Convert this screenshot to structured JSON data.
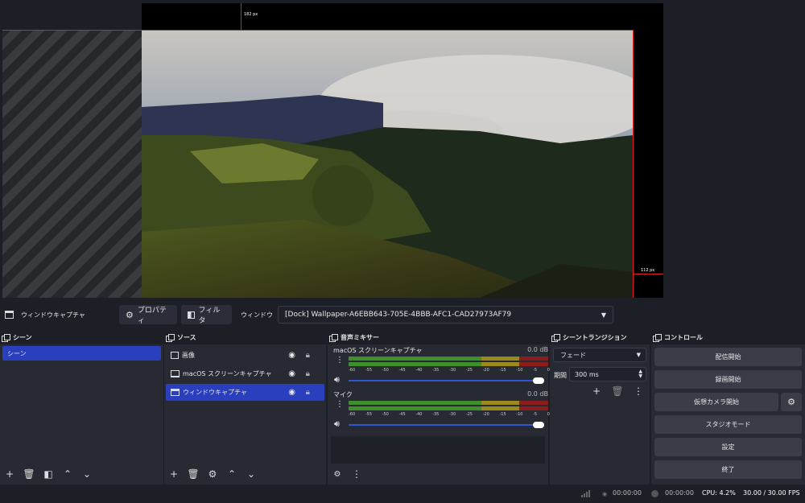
{
  "preview": {
    "guide_top_label": "182 px",
    "guide_right_label": "112 px"
  },
  "context_bar": {
    "source_name": "ウィンドウキャプチャ",
    "properties_label": "プロパティ",
    "filters_label": "フィルタ",
    "window_label": "ウィンドウ",
    "window_value": "[Dock] Wallpaper-A6EBB643-705E-4BBB-AFC1-CAD27973AF79"
  },
  "scenes": {
    "title": "シーン",
    "items": [
      "シーン"
    ]
  },
  "sources": {
    "title": "ソース",
    "items": [
      {
        "label": "画像",
        "icon": "image-icon"
      },
      {
        "label": "macOS スクリーンキャプチャ",
        "icon": "monitor-icon"
      },
      {
        "label": "ウィンドウキャプチャ",
        "icon": "window-icon"
      }
    ]
  },
  "mixer": {
    "title": "音声ミキサー",
    "channels": [
      {
        "name": "macOS スクリーンキャプチャ",
        "db": "0.0 dB"
      },
      {
        "name": "マイク",
        "db": "0.0 dB"
      }
    ],
    "scale": [
      "-60",
      "-55",
      "-50",
      "-45",
      "-40",
      "-35",
      "-30",
      "-25",
      "-20",
      "-15",
      "-10",
      "-5",
      "0"
    ]
  },
  "transitions": {
    "title": "シーントランジション",
    "type": "フェード",
    "duration_label": "期間",
    "duration_value": "300 ms"
  },
  "controls": {
    "title": "コントロール",
    "buttons": [
      "配信開始",
      "録画開始",
      "仮想カメラ開始",
      "スタジオモード",
      "設定",
      "終了"
    ]
  },
  "status": {
    "stream_time": "00:00:00",
    "record_time": "00:00:00",
    "cpu": "CPU: 4.2%",
    "fps": "30.00 / 30.00 FPS"
  },
  "colors": {
    "accent": "#2a3fbe",
    "meter_green": "#3f8f2a",
    "meter_yellow": "#9a8a1e",
    "meter_red": "#8a1c1c"
  }
}
